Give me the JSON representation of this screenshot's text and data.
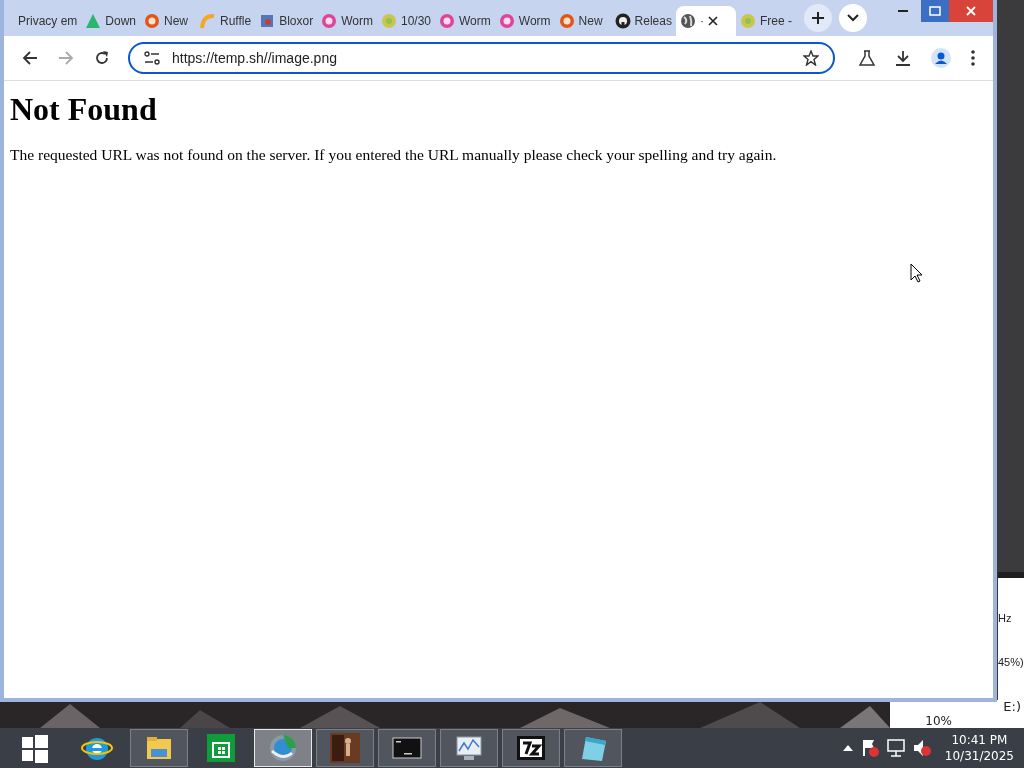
{
  "browser": {
    "tabs": [
      {
        "label": "Privacy em",
        "selected": false
      },
      {
        "label": "Down",
        "selected": false
      },
      {
        "label": "New",
        "selected": false
      },
      {
        "label": "Ruffle",
        "selected": false
      },
      {
        "label": "Bloxor",
        "selected": false
      },
      {
        "label": "Worm",
        "selected": false
      },
      {
        "label": "10/30",
        "selected": false
      },
      {
        "label": "Worm",
        "selected": false
      },
      {
        "label": "Worm",
        "selected": false
      },
      {
        "label": "New",
        "selected": false
      },
      {
        "label": "Releas",
        "selected": false
      },
      {
        "label": "·",
        "selected": true
      },
      {
        "label": "Free -",
        "selected": false
      }
    ],
    "address": "https://temp.sh//image.png",
    "page": {
      "heading": "Not Found",
      "message": "The requested URL was not found on the server. If you entered the URL manually please check your spelling and try again."
    }
  },
  "background_window": {
    "texts": [
      "Hz",
      "45%)"
    ]
  },
  "background_panel": {
    "texts": [
      "E:)",
      "10%"
    ]
  },
  "taskbar": {
    "items": [
      {
        "running": false,
        "selected": false
      },
      {
        "running": false,
        "selected": false
      },
      {
        "running": true,
        "selected": false
      },
      {
        "running": false,
        "selected": false
      },
      {
        "running": true,
        "selected": true
      },
      {
        "running": true,
        "selected": false
      },
      {
        "running": true,
        "selected": false
      },
      {
        "running": true,
        "selected": false
      },
      {
        "running": true,
        "selected": false
      },
      {
        "running": true,
        "selected": false
      }
    ],
    "time": "10:41 PM",
    "date": "10/31/2025"
  }
}
